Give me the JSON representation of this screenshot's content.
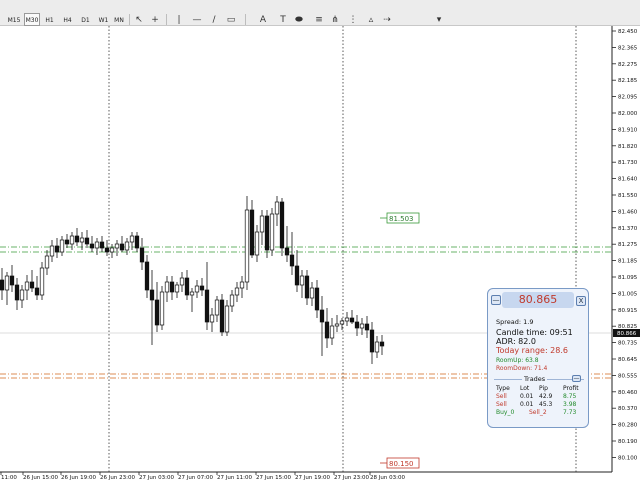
{
  "toolbar": {
    "timeframes": [
      "M15",
      "M30",
      "H1",
      "H4",
      "D1",
      "W1",
      "MN"
    ],
    "selected_timeframe": "M30",
    "tools": [
      {
        "name": "cursor-icon",
        "glyph": "↖"
      },
      {
        "name": "crosshair-icon",
        "glyph": "+"
      },
      {
        "name": "vertical-line-icon",
        "glyph": "|"
      },
      {
        "name": "horizontal-line-icon",
        "glyph": "—"
      },
      {
        "name": "trendline-icon",
        "glyph": "/"
      },
      {
        "name": "channel-icon",
        "glyph": "▭"
      },
      {
        "name": "text-icon",
        "glyph": "A"
      },
      {
        "name": "label-icon",
        "glyph": "T"
      },
      {
        "name": "ellipse-icon",
        "glyph": "⬬"
      },
      {
        "name": "fibonacci-icon",
        "glyph": "≡"
      },
      {
        "name": "pitchfork-icon",
        "glyph": "⋔"
      },
      {
        "name": "cycle-lines-icon",
        "glyph": "⋮"
      },
      {
        "name": "triangle-icon",
        "glyph": "▵"
      },
      {
        "name": "arrow-icon",
        "glyph": "⇢"
      },
      {
        "name": "more-tools-icon",
        "glyph": "▾"
      }
    ]
  },
  "chart": {
    "price_axis": [
      "82.450",
      "82.365",
      "82.275",
      "82.185",
      "82.095",
      "82.000",
      "81.910",
      "81.820",
      "81.730",
      "81.640",
      "81.550",
      "81.460",
      "81.370",
      "81.275",
      "81.185",
      "81.095",
      "81.005",
      "80.915",
      "80.825",
      "80.735",
      "80.645",
      "80.555",
      "80.460",
      "80.370",
      "80.280",
      "80.190",
      "80.100"
    ],
    "current_price": "80.866",
    "time_axis": [
      "11:00",
      "26 Jun 15:00",
      "26 Jun 19:00",
      "26 Jun 23:00",
      "27 Jun 03:00",
      "27 Jun 07:00",
      "27 Jun 11:00",
      "27 Jun 15:00",
      "27 Jun 19:00",
      "27 Jun 23:00",
      "28 Jun 03:00"
    ],
    "label_high": "81.503",
    "label_low": "80.150"
  },
  "panel": {
    "price": "80.865",
    "close_glyph": "X",
    "minimize_glyph": "—",
    "spread": "Spread: 1.9",
    "candle_time": "Candle time: 09:51",
    "adr": "ADR: 82.0",
    "today_range": "Today range: 28.6",
    "room_up": "RoomUp: 63.8",
    "room_down": "RoomDown: 71.4",
    "trades_title": "Trades",
    "headers": [
      "Type",
      "Lot",
      "Pip",
      "Profit"
    ],
    "rows": [
      {
        "type": "Sell",
        "lot": "0.01",
        "pip": "42.9",
        "profit": "8.75"
      },
      {
        "type": "Sell",
        "lot": "0.01",
        "pip": "45.3",
        "profit": "3.98"
      }
    ],
    "footer": {
      "a": "Buy_0",
      "b": "Sell_2",
      "c": "7.73"
    }
  }
}
